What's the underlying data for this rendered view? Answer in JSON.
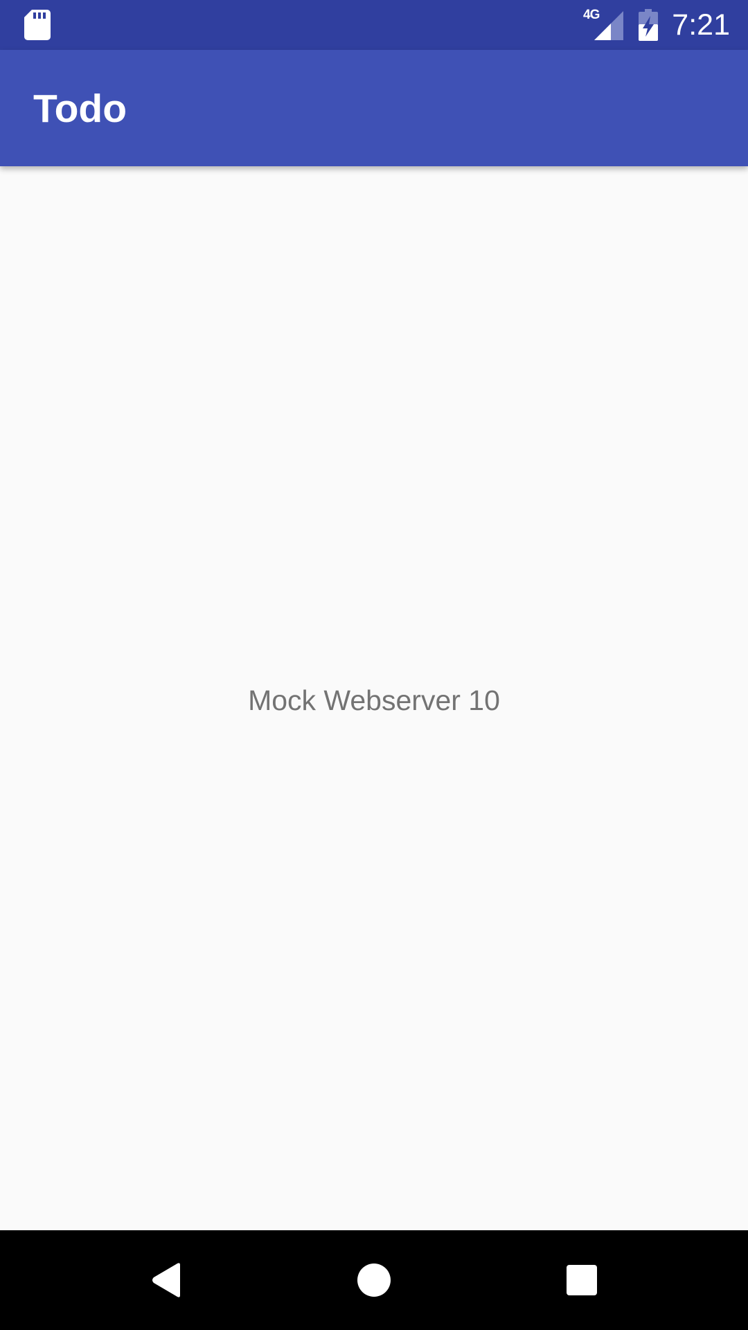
{
  "status_bar": {
    "time": "7:21",
    "network_type": "4G",
    "icons": [
      "sd-card-icon",
      "cellular-signal-icon",
      "battery-charging-icon"
    ],
    "colors": {
      "background": "#303F9F"
    }
  },
  "app_bar": {
    "title": "Todo",
    "colors": {
      "background": "#3F51B5",
      "text": "#FFFFFF"
    }
  },
  "main": {
    "message": "Mock Webserver 10",
    "colors": {
      "background": "#FAFAFA",
      "text": "#737373"
    }
  },
  "nav_bar": {
    "buttons": [
      "back-icon",
      "home-icon",
      "recents-icon"
    ]
  }
}
